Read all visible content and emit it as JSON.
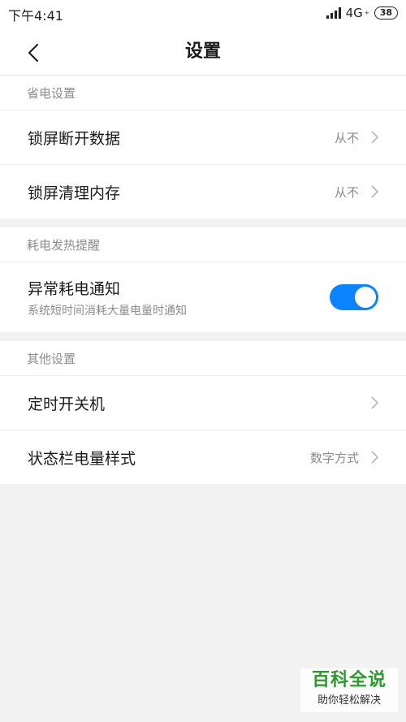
{
  "status_bar": {
    "time": "下午4:41",
    "network": "4G",
    "network_sub": "+",
    "battery": "38"
  },
  "header": {
    "title": "设置"
  },
  "sections": [
    {
      "header": "省电设置",
      "rows": [
        {
          "label": "锁屏断开数据",
          "value": "从不"
        },
        {
          "label": "锁屏清理内存",
          "value": "从不"
        }
      ]
    },
    {
      "header": "耗电发热提醒",
      "toggle": {
        "title": "异常耗电通知",
        "subtitle": "系统短时间消耗大量电量时通知",
        "enabled": true
      }
    },
    {
      "header": "其他设置",
      "rows": [
        {
          "label": "定时开关机",
          "value": ""
        },
        {
          "label": "状态栏电量样式",
          "value": "数字方式"
        }
      ]
    }
  ],
  "watermark": {
    "main": "百科全说",
    "sub": "助你轻松解决"
  },
  "colors": {
    "accent": "#0d84ff",
    "background": "#f2f2f2"
  }
}
